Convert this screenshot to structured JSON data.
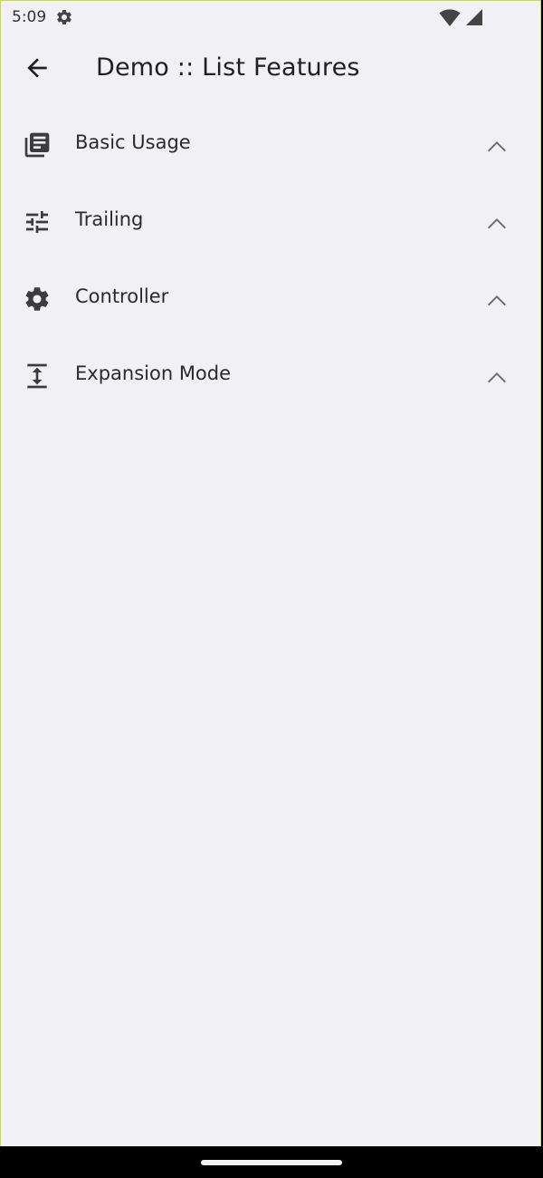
{
  "status_bar": {
    "time": "5:09",
    "icons": [
      "settings-gear-icon",
      "wifi-icon",
      "cell-signal-icon"
    ]
  },
  "app_bar": {
    "back_icon": "back-arrow-icon",
    "title": "Demo :: List Features"
  },
  "features": [
    {
      "label": "Basic Usage",
      "icon": "library-books-icon",
      "expanded": true
    },
    {
      "label": "Trailing",
      "icon": "tune-sliders-icon",
      "expanded": true
    },
    {
      "label": "Controller",
      "icon": "settings-gear-icon",
      "expanded": true
    },
    {
      "label": "Expansion Mode",
      "icon": "expand-height-icon",
      "expanded": true
    }
  ],
  "colors": {
    "background": "#f0f0f5",
    "text": "#1f1f23",
    "icon": "#3b3b40",
    "chevron": "#6a6a70",
    "frame_accent": "#c9dc3a"
  }
}
